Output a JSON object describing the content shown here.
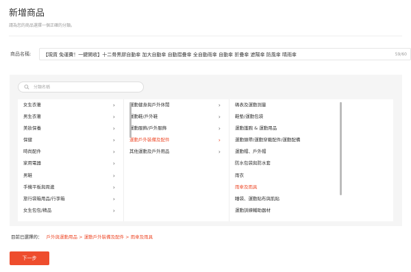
{
  "header": {
    "title": "新增商品",
    "subtitle": "請為您的商品選擇一個正確的分類。"
  },
  "product_name": {
    "label": "商品名稱:",
    "value": "【現貨 免運費！一鍵開收】十二骨黑膠自動傘 加大自動傘 自動摺疊傘 全自動雨傘 自動傘 折疊傘 遮陽傘 防風傘 晴雨傘",
    "count": "59/60"
  },
  "search": {
    "placeholder": "分類名稱"
  },
  "columns": {
    "level1": [
      {
        "label": "女生衣著"
      },
      {
        "label": "男生衣著"
      },
      {
        "label": "美妝保養"
      },
      {
        "label": "保健"
      },
      {
        "label": "時尚配件"
      },
      {
        "label": "家用電器"
      },
      {
        "label": "男鞋"
      },
      {
        "label": "手機平板與周邊"
      },
      {
        "label": "旅行袋箱用品/行李箱"
      },
      {
        "label": "女生包包/精品"
      }
    ],
    "level2": [
      {
        "label": "運動健身與戶外休閒"
      },
      {
        "label": "運動鞋/戶外鞋"
      },
      {
        "label": "運動服飾/戶外服飾"
      },
      {
        "label": "運動戶外裝備及配件"
      },
      {
        "label": "其他運動及戶外用品"
      }
    ],
    "level3": [
      {
        "label": "碼表及運動測量"
      },
      {
        "label": "鞋墊/運動包袋"
      },
      {
        "label": "運動護腕 & 運動用品"
      },
      {
        "label": "運動頭帶/運動穿戴配件/運動配備"
      },
      {
        "label": "運動帽、戶外帽"
      },
      {
        "label": "防水包袋與防水套"
      },
      {
        "label": "雨衣"
      },
      {
        "label": "雨傘及雨具"
      },
      {
        "label": "睡袋、運動貼布與肌貼"
      },
      {
        "label": "運動訓練輔助器材"
      }
    ]
  },
  "selection": {
    "label": "目前已選擇的：",
    "path": "戶外與運動用品 > 運動戶外裝備及配件 > 雨傘及雨具"
  },
  "actions": {
    "next_label": "下一步"
  },
  "colors": {
    "accent": "#ee4d2d"
  }
}
